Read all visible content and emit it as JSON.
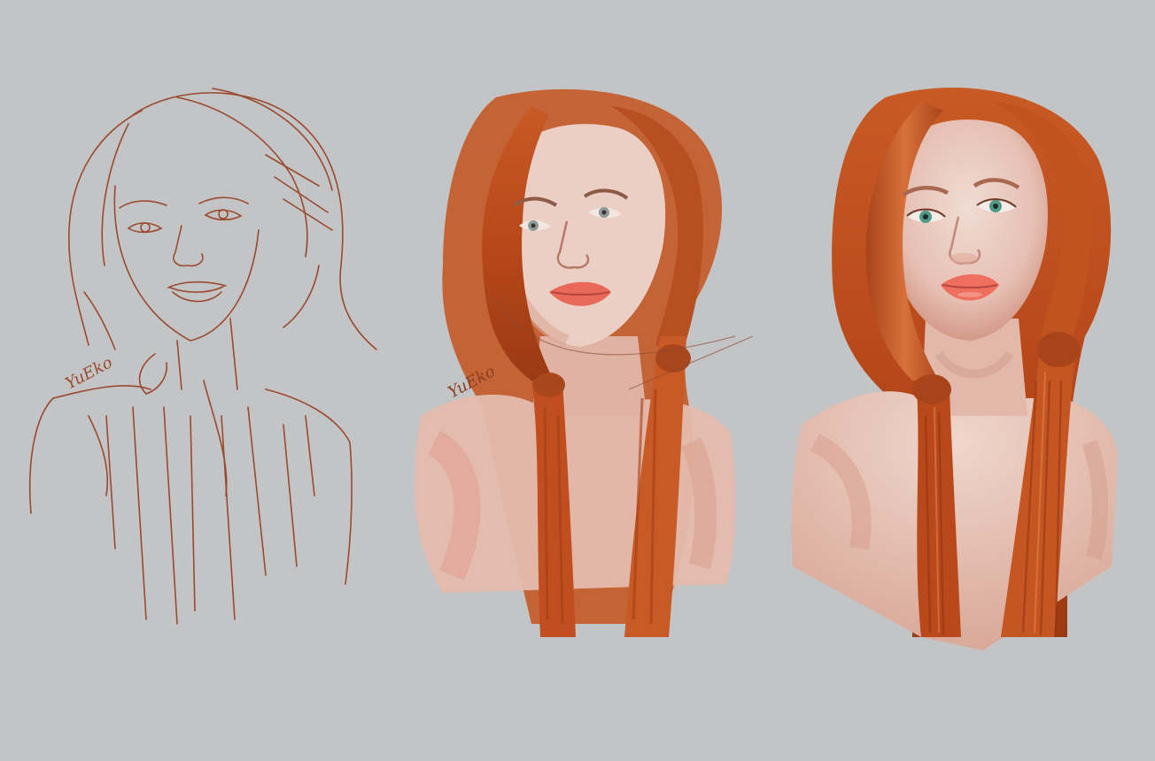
{
  "colors": {
    "background": "#c3c4c6",
    "sketch_line": "#9a4a2e",
    "hair_main": "#c8561f",
    "hair_dark": "#9b3d15",
    "hair_light": "#e07a42",
    "skin_light": "#edd3c9",
    "skin_mid": "#e3b3a5",
    "skin_shadow": "#c98a7a",
    "lips": "#e8685a",
    "iris_rough": "#8d9a98",
    "iris_final": "#4f9a86"
  },
  "stages": [
    {
      "stage": "line-sketch"
    },
    {
      "stage": "color-blocking"
    },
    {
      "stage": "final-render"
    }
  ],
  "signature": {
    "text": "YuEko"
  }
}
